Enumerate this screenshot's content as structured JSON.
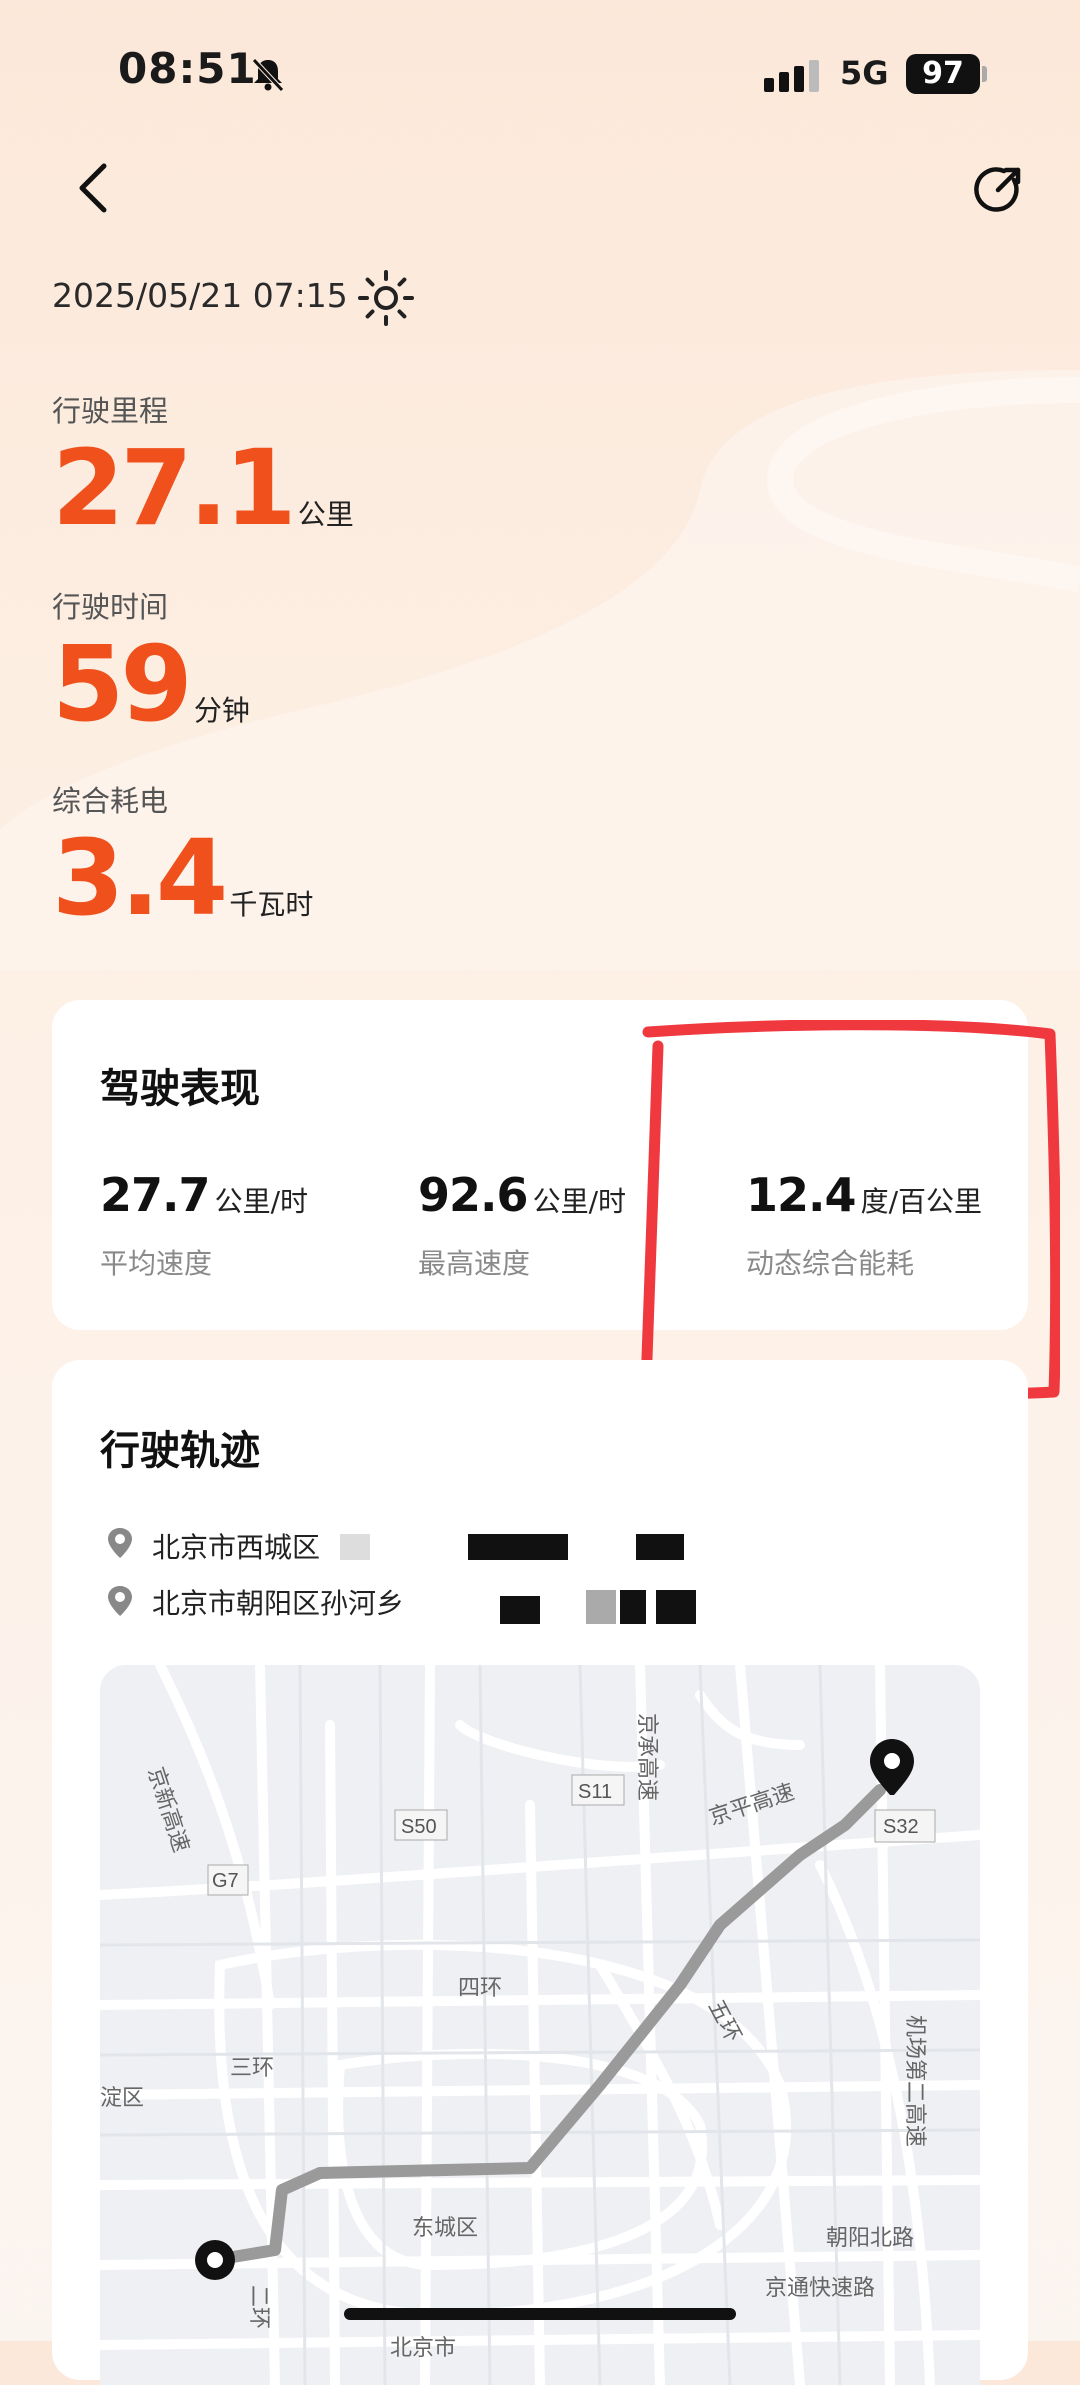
{
  "status_bar": {
    "time": "08:51",
    "network": "5G",
    "battery": "97"
  },
  "trip": {
    "datetime": "2025/05/21 07:15"
  },
  "stats": [
    {
      "label": "行驶里程",
      "value": "27.1",
      "unit": "公里"
    },
    {
      "label": "行驶时间",
      "value": "59",
      "unit": "分钟"
    },
    {
      "label": "综合耗电",
      "value": "3.4",
      "unit": "千瓦时"
    }
  ],
  "performance": {
    "title": "驾驶表现",
    "metrics": [
      {
        "value": "27.7",
        "unit": "公里/时",
        "label": "平均速度"
      },
      {
        "value": "92.6",
        "unit": "公里/时",
        "label": "最高速度"
      },
      {
        "value": "12.4",
        "unit": "度/百公里",
        "label": "动态综合能耗"
      }
    ]
  },
  "track": {
    "title": "行驶轨迹",
    "start_address": "北京市西城区",
    "end_address": "北京市朝阳区孙河乡"
  },
  "map": {
    "labels": {
      "jingxin": "京新高速",
      "jingcheng": "京承高速",
      "jingping": "京平高速",
      "s50": "S50",
      "s11": "S11",
      "s32": "S32",
      "g7": "G7",
      "sihuan": "四环",
      "sanhuan": "三环",
      "wuhuan": "五环",
      "airport2": "机场第二高速",
      "dongcheng": "东城区",
      "haidian": "淀区",
      "chaoyang_north": "朝阳北路",
      "jingtong": "京通快速路",
      "erhuan": "二环",
      "beijing": "北京市"
    }
  },
  "colors": {
    "accent": "#f0501c",
    "annotation": "#f0393f",
    "route": "#9a9a9a"
  }
}
